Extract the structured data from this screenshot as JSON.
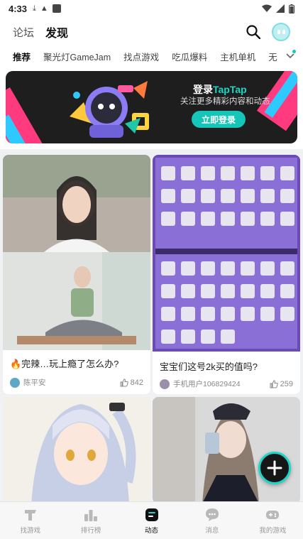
{
  "status_bar": {
    "time": "4:33"
  },
  "header": {
    "tabs": [
      {
        "label": "论坛",
        "active": false
      },
      {
        "label": "发现",
        "active": true
      }
    ]
  },
  "categories": [
    {
      "label": "推荐",
      "active": true
    },
    {
      "label": "聚光灯GameJam",
      "active": false
    },
    {
      "label": "找点游戏",
      "active": false
    },
    {
      "label": "吃瓜爆料",
      "active": false
    },
    {
      "label": "主机单机",
      "active": false
    },
    {
      "label": "无限暖暖",
      "active": false
    }
  ],
  "banner": {
    "title_prefix": "登录",
    "title_brand": "TapTap",
    "subtitle": "关注更多精彩内容和动态",
    "button": "立即登录"
  },
  "feed": [
    {
      "title": "🔥完辣…玩上瘾了怎么办?",
      "author": "陈平安",
      "likes": "842"
    },
    {
      "title": "宝宝们这号2k买的值吗?",
      "author": "手机用户106829424",
      "likes": "259"
    },
    {
      "title": "",
      "author": "",
      "likes": ""
    },
    {
      "title": "",
      "author": "",
      "likes": ""
    }
  ],
  "bottom_nav": [
    {
      "label": "找游戏",
      "icon": "game-icon",
      "active": false
    },
    {
      "label": "排行榜",
      "icon": "ranking-icon",
      "active": false
    },
    {
      "label": "动态",
      "icon": "feed-icon",
      "active": true
    },
    {
      "label": "消息",
      "icon": "message-icon",
      "active": false
    },
    {
      "label": "我的游戏",
      "icon": "controller-icon",
      "active": false
    }
  ],
  "colors": {
    "accent": "#19d7c5",
    "banner_bg": "#1e1e1e",
    "pink": "#ff3a7f"
  }
}
